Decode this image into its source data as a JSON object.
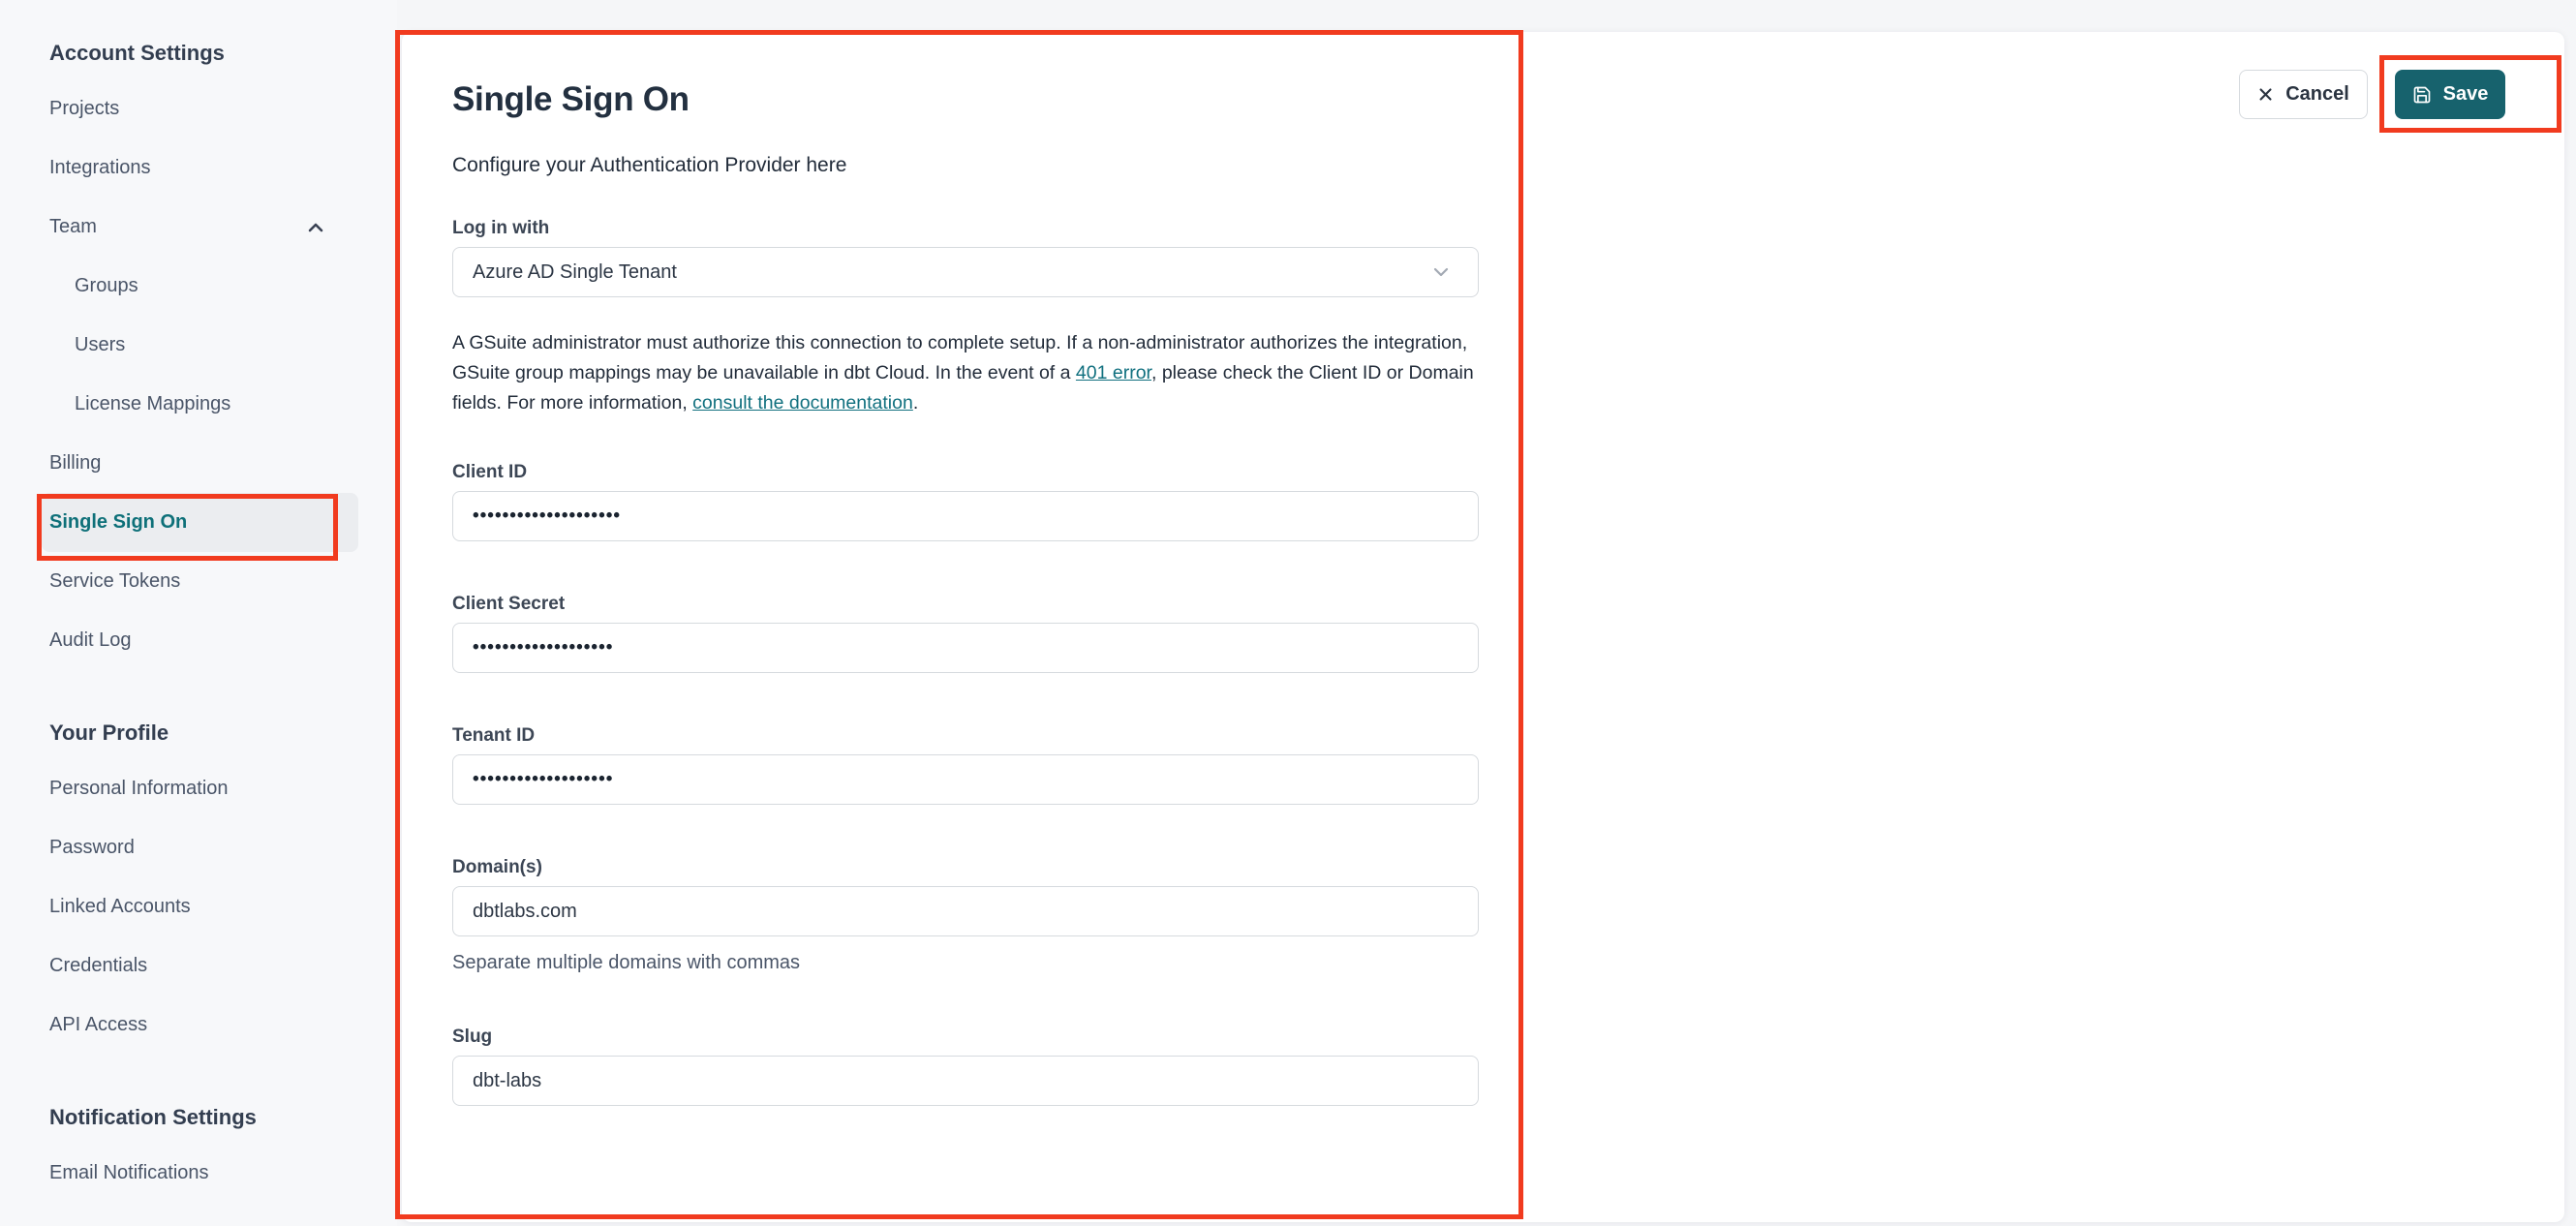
{
  "colors": {
    "accent_teal": "#0E7079",
    "save_button_teal": "#17626D",
    "annotation_red": "#F13B1F",
    "card_background": "#FFFFFF",
    "page_background": "#F5F6F8"
  },
  "sidebar": {
    "sections": [
      {
        "header": "Account Settings",
        "items": [
          {
            "label": "Projects"
          },
          {
            "label": "Integrations"
          },
          {
            "label": "Team",
            "chevron": "up"
          },
          {
            "label": "Groups",
            "sub": true
          },
          {
            "label": "Users",
            "sub": true
          },
          {
            "label": "License Mappings",
            "sub": true
          },
          {
            "label": "Billing"
          },
          {
            "label": "Single Sign On",
            "active": true
          },
          {
            "label": "Service Tokens"
          },
          {
            "label": "Audit Log"
          }
        ]
      },
      {
        "header": "Your Profile",
        "items": [
          {
            "label": "Personal Information"
          },
          {
            "label": "Password"
          },
          {
            "label": "Linked Accounts"
          },
          {
            "label": "Credentials"
          },
          {
            "label": "API Access"
          }
        ]
      },
      {
        "header": "Notification Settings",
        "items": [
          {
            "label": "Email Notifications"
          }
        ]
      }
    ]
  },
  "main": {
    "title": "Single Sign On",
    "subtitle": "Configure your Authentication Provider here",
    "login": {
      "label": "Log in with",
      "value": "Azure AD Single Tenant"
    },
    "note": {
      "p1": "A GSuite administrator must authorize this connection to complete setup. If a non-administrator authorizes the integration, GSuite group mappings may be unavailable in dbt Cloud. In the event of a ",
      "link1": "401 error",
      "p2": ", please check the Client ID or Domain fields. For more information, ",
      "link2": "consult the documentation",
      "p3": "."
    },
    "fields": [
      {
        "label": "Client ID",
        "value": "••••••••••••••••••••",
        "masked": true
      },
      {
        "label": "Client Secret",
        "value": "•••••••••••••••••••",
        "masked": true
      },
      {
        "label": "Tenant ID",
        "value": "•••••••••••••••••••",
        "masked": true
      },
      {
        "label": "Domain(s)",
        "value": "dbtlabs.com",
        "masked": false,
        "helper": "Separate multiple domains with commas"
      },
      {
        "label": "Slug",
        "value": "dbt-labs",
        "masked": false
      }
    ],
    "actions": {
      "cancel": "Cancel",
      "save": "Save"
    }
  }
}
